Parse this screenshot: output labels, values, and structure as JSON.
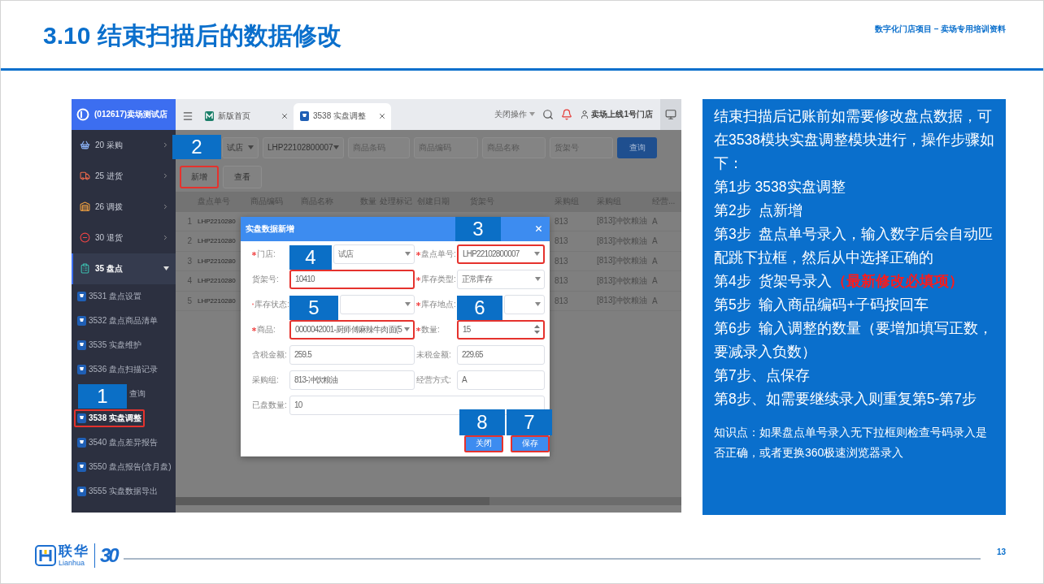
{
  "slide": {
    "title": "3.10 结束扫描后的数据修改",
    "subtitle": "数字化门店项目 – 卖场专用培训资料",
    "page_number": "13"
  },
  "app": {
    "sidebar": {
      "store": "(012617)卖场测试店",
      "groups": [
        {
          "label": "20 采购",
          "kind": "basket",
          "expanded": false
        },
        {
          "label": "25 进货",
          "kind": "truck",
          "expanded": false
        },
        {
          "label": "26 调拨",
          "kind": "transfer",
          "expanded": false
        },
        {
          "label": "30 退货",
          "kind": "return",
          "expanded": false
        },
        {
          "label": "35 盘点",
          "kind": "clipboard",
          "expanded": true,
          "children": [
            {
              "label": "3531 盘点设置",
              "icon": true,
              "selected": false,
              "highlighted": false
            },
            {
              "label": "3532 盘点商品清单",
              "icon": true,
              "selected": false,
              "highlighted": false
            },
            {
              "label": "3535 实盘维护",
              "icon": true,
              "selected": false,
              "highlighted": false
            },
            {
              "label": "3536 盘点扫描记录",
              "icon": true,
              "selected": false,
              "highlighted": false
            },
            {
              "label": "查询",
              "icon": false,
              "selected": false,
              "highlighted": false
            },
            {
              "label": "3538 实盘调整",
              "icon": true,
              "selected": true,
              "highlighted": true
            },
            {
              "label": "3540 盘点差异报告",
              "icon": true,
              "selected": false,
              "highlighted": false
            },
            {
              "label": "3550 盘点报告(含月盘)",
              "icon": true,
              "selected": false,
              "highlighted": false
            },
            {
              "label": "3555 实盘数据导出",
              "icon": true,
              "selected": false,
              "highlighted": false
            }
          ]
        }
      ]
    },
    "tabs": [
      {
        "label": "新版首页",
        "kind": "home",
        "selected": false
      },
      {
        "label": "3538 实盘调整",
        "kind": "page",
        "selected": true
      }
    ],
    "toolbar": {
      "operations": "关闭操作",
      "user": "卖场上线1号门店"
    },
    "filters": [
      {
        "kind": "select",
        "value": "试店"
      },
      {
        "kind": "select",
        "value": "LHP22102800007"
      },
      {
        "kind": "input",
        "placeholder": "商品条码"
      },
      {
        "kind": "input",
        "placeholder": "商品编码"
      },
      {
        "kind": "input",
        "placeholder": "商品名称"
      },
      {
        "kind": "input",
        "placeholder": "货架号"
      }
    ],
    "search_button": "查询",
    "actions": [
      {
        "label": "新增",
        "highlighted": true
      },
      {
        "label": "查看",
        "highlighted": false
      }
    ],
    "table": {
      "columns": [
        "盘点单号",
        "商品编码",
        "商品名称",
        "数量",
        "处理标记",
        "创建日期",
        "货架号",
        "采购组",
        "采购组",
        "经营..."
      ],
      "rows": [
        {
          "index": "1",
          "order_no": "LHP2210280",
          "group": "813",
          "group_name": "[813]冲饮粮油",
          "mode": "A"
        },
        {
          "index": "2",
          "order_no": "LHP2210280",
          "group": "813",
          "group_name": "[813]冲饮粮油",
          "mode": "A"
        },
        {
          "index": "3",
          "order_no": "LHP2210280",
          "group": "813",
          "group_name": "[813]冲饮粮油",
          "mode": "A"
        },
        {
          "index": "4",
          "order_no": "LHP2210280",
          "group": "813",
          "group_name": "[813]冲饮粮油",
          "mode": "A"
        },
        {
          "index": "5",
          "order_no": "LHP2210280",
          "group": "813",
          "group_name": "[813]冲饮粮油",
          "mode": "A"
        }
      ]
    },
    "dialog": {
      "title": "实盘数据新增",
      "fields": [
        {
          "label": "门店:",
          "kind": "select",
          "required": true,
          "highlighted": false,
          "value": "试店"
        },
        {
          "label": "盘点单号:",
          "kind": "select",
          "required": true,
          "highlighted": true,
          "value": "LHP22102800007"
        },
        {
          "label": "货架号:",
          "kind": "input",
          "required": false,
          "highlighted": true,
          "value": "10410"
        },
        {
          "label": "库存类型:",
          "kind": "select",
          "required": true,
          "highlighted": false,
          "value": "正常库存"
        },
        {
          "label": "库存状态:",
          "kind": "select",
          "required": true,
          "highlighted": false
        },
        {
          "label": "库存地点:",
          "kind": "select",
          "required": true,
          "highlighted": false
        },
        {
          "label": "商品:",
          "kind": "select",
          "required": true,
          "highlighted": true,
          "value": "0000042001-厨师傅麻辣牛肉面(5"
        },
        {
          "label": "数量:",
          "kind": "number",
          "required": true,
          "highlighted": true,
          "value": "15"
        },
        {
          "label": "含税金额:",
          "kind": "input",
          "required": false,
          "highlighted": false,
          "value": "259.5"
        },
        {
          "label": "未税金额:",
          "kind": "input",
          "required": false,
          "highlighted": false,
          "value": "229.65"
        },
        {
          "label": "采购组:",
          "kind": "input",
          "required": false,
          "highlighted": false,
          "value": "813-冲饮粮油"
        },
        {
          "label": "经营方式:",
          "kind": "input",
          "required": false,
          "highlighted": false,
          "value": "A"
        },
        {
          "label": "已盘数量:",
          "kind": "input",
          "required": false,
          "highlighted": false,
          "value": "10"
        }
      ],
      "buttons": [
        {
          "label": "关闭",
          "highlighted": true
        },
        {
          "label": "保存",
          "highlighted": true
        }
      ]
    },
    "step_markers": [
      "2",
      "3",
      "4",
      "5",
      "6",
      "1",
      "8",
      "7"
    ]
  },
  "instructions": {
    "intro": "结束扫描后记账前如需要修改盘点数据，可在3538模块实盘调整模块进行，操作步骤如下：",
    "steps": [
      {
        "text": "第1步 3538实盘调整"
      },
      {
        "text": "第2步  点新增"
      },
      {
        "text": "第3步  盘点单号录入，输入数字后会自动匹配跳下拉框，然后从中选择正确的"
      },
      {
        "text": "第4步  货架号录入",
        "note": "（最新修改必填项）"
      },
      {
        "text": "第5步  输入商品编码+子码按回车"
      },
      {
        "text": "第6步  输入调整的数量（要增加填写正数，要减录入负数）"
      },
      {
        "text": "第7步、点保存"
      },
      {
        "text": "第8步、如需要继续录入则重复第5-第7步"
      }
    ],
    "knowledge": "知识点：如果盘点单号录入无下拉框则检查号码录入是否正确，或者更换360极速浏览器录入"
  },
  "logo": {
    "name": "联华",
    "latin": "Lianhua",
    "anniversary": "30"
  }
}
